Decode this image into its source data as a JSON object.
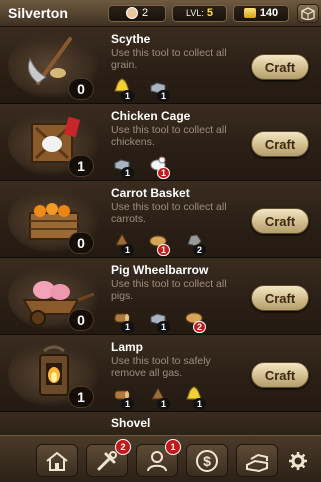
{
  "header": {
    "town": "Silverton",
    "population": "2",
    "level_label": "LVL:",
    "level_value": "5",
    "gold": "140"
  },
  "tools": [
    {
      "name": "Scythe",
      "description": "Use this tool to collect all grain.",
      "count": "0",
      "craft_label": "Craft",
      "requirements": [
        {
          "icon": "bell-icon",
          "qty": "1",
          "alert": false
        },
        {
          "icon": "metal-ingot-icon",
          "qty": "1",
          "alert": false
        }
      ]
    },
    {
      "name": "Chicken Cage",
      "description": "Use this tool to collect all chickens.",
      "count": "1",
      "craft_label": "Craft",
      "requirements": [
        {
          "icon": "metal-ingot-icon",
          "qty": "1",
          "alert": false
        },
        {
          "icon": "chicken-icon",
          "qty": "1",
          "alert": true
        }
      ]
    },
    {
      "name": "Carrot Basket",
      "description": "Use this tool to collect all carrots.",
      "count": "0",
      "craft_label": "Craft",
      "requirements": [
        {
          "icon": "wood-icon",
          "qty": "1",
          "alert": false
        },
        {
          "icon": "bread-icon",
          "qty": "1",
          "alert": true
        },
        {
          "icon": "stone-icon",
          "qty": "2",
          "alert": false
        }
      ]
    },
    {
      "name": "Pig Wheelbarrow",
      "description": "Use this tool to collect all pigs.",
      "count": "0",
      "craft_label": "Craft",
      "requirements": [
        {
          "icon": "log-icon",
          "qty": "1",
          "alert": false
        },
        {
          "icon": "metal-ingot-icon",
          "qty": "1",
          "alert": false
        },
        {
          "icon": "bread-icon",
          "qty": "2",
          "alert": true
        }
      ]
    },
    {
      "name": "Lamp",
      "description": "Use this tool to safely remove all gas.",
      "count": "1",
      "craft_label": "Craft",
      "requirements": [
        {
          "icon": "log-icon",
          "qty": "1",
          "alert": false
        },
        {
          "icon": "wood-icon",
          "qty": "1",
          "alert": false
        },
        {
          "icon": "bell-icon",
          "qty": "1",
          "alert": false
        }
      ]
    }
  ],
  "partial_tool": {
    "name": "Shovel"
  },
  "nav": {
    "items": [
      {
        "icon": "house-icon",
        "badge": ""
      },
      {
        "icon": "tools-icon",
        "badge": "2"
      },
      {
        "icon": "worker-icon",
        "badge": "1"
      },
      {
        "icon": "dollar-coin-icon",
        "badge": ""
      },
      {
        "icon": "ingots-icon",
        "badge": ""
      }
    ],
    "settings_icon": "gear-icon"
  }
}
